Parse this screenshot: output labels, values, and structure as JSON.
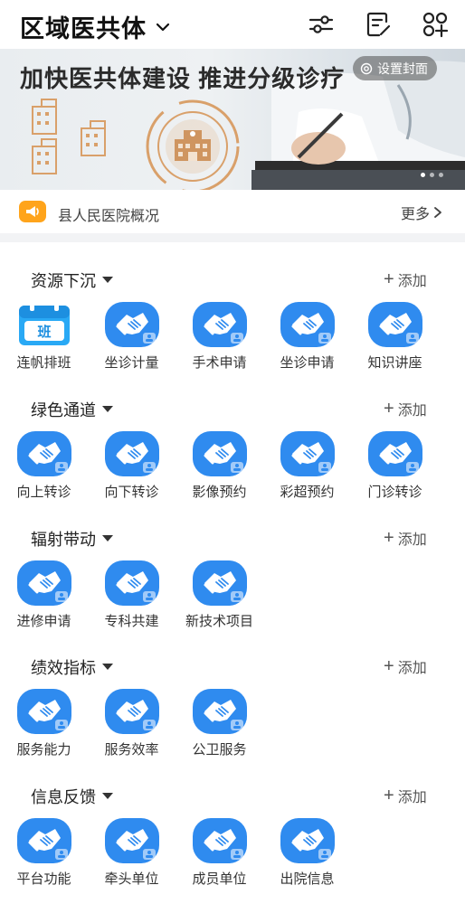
{
  "header": {
    "title": "区域医共体",
    "icons": [
      "chevron-down-icon",
      "filter-sliders-icon",
      "edit-list-icon",
      "add-apps-icon"
    ]
  },
  "banner": {
    "headline": "加快医共体建设  推进分级诊疗",
    "cover_button": "设置封面",
    "slide_count": 3,
    "active_slide": 1
  },
  "notice": {
    "text": "县人民医院概况",
    "more": "更多"
  },
  "colors": {
    "accent_blue": "#2f8bef",
    "notice_orange": "#ffa41b",
    "section_bg": "#f2f3f5"
  },
  "add_label": "添加",
  "sections": [
    {
      "title": "资源下沉",
      "items": [
        {
          "label": "连帆排班",
          "icon": "schedule-calendar-icon"
        },
        {
          "label": "坐诊计量",
          "icon": "handshake-icon"
        },
        {
          "label": "手术申请",
          "icon": "handshake-icon"
        },
        {
          "label": "坐诊申请",
          "icon": "handshake-icon"
        },
        {
          "label": "知识讲座",
          "icon": "handshake-icon"
        }
      ]
    },
    {
      "title": "绿色通道",
      "items": [
        {
          "label": "向上转诊",
          "icon": "handshake-icon"
        },
        {
          "label": "向下转诊",
          "icon": "handshake-icon"
        },
        {
          "label": "影像预约",
          "icon": "handshake-icon"
        },
        {
          "label": "彩超预约",
          "icon": "handshake-icon"
        },
        {
          "label": "门诊转诊",
          "icon": "handshake-icon"
        }
      ]
    },
    {
      "title": "辐射带动",
      "items": [
        {
          "label": "进修申请",
          "icon": "handshake-icon"
        },
        {
          "label": "专科共建",
          "icon": "handshake-icon"
        },
        {
          "label": "新技术项目",
          "icon": "handshake-icon"
        }
      ]
    },
    {
      "title": "绩效指标",
      "items": [
        {
          "label": "服务能力",
          "icon": "handshake-icon"
        },
        {
          "label": "服务效率",
          "icon": "handshake-icon"
        },
        {
          "label": "公卫服务",
          "icon": "handshake-icon"
        }
      ]
    },
    {
      "title": "信息反馈",
      "items": [
        {
          "label": "平台功能",
          "icon": "handshake-icon"
        },
        {
          "label": "牵头单位",
          "icon": "handshake-icon"
        },
        {
          "label": "成员单位",
          "icon": "handshake-icon"
        },
        {
          "label": "出院信息",
          "icon": "handshake-icon"
        }
      ]
    }
  ]
}
